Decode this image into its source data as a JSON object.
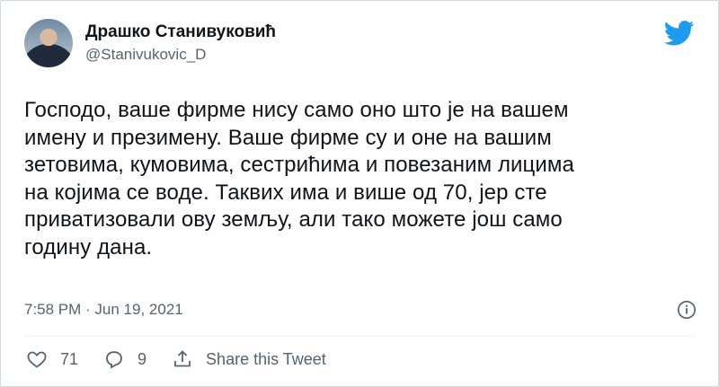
{
  "author": {
    "display_name": "Драшко Станивуковић",
    "handle": "@Stanivukovic_D",
    "avatar_icon": "avatar-photo"
  },
  "tweet": {
    "text": "Господо, ваше фирме нису само оно што је на вашем\nимену и презимену. Ваше фирме су и оне на вашим\nзетовима, кумовима, сестрићима и повезаним лицима\nна којима се воде. Таквих има и више од 70, јер сте\nприватизовали ову земљу, али тако можете још само\nгодину дана.",
    "timestamp": "7:58 PM · Jun 19, 2021"
  },
  "actions": {
    "likes": "71",
    "replies": "9",
    "share_label": "Share this Tweet"
  },
  "icons": {
    "brand": "twitter-bird-icon",
    "info": "info-icon",
    "like": "heart-icon",
    "reply": "reply-icon",
    "share": "share-icon"
  },
  "colors": {
    "twitter_blue": "#1d9bf0",
    "secondary_text": "#536471"
  }
}
